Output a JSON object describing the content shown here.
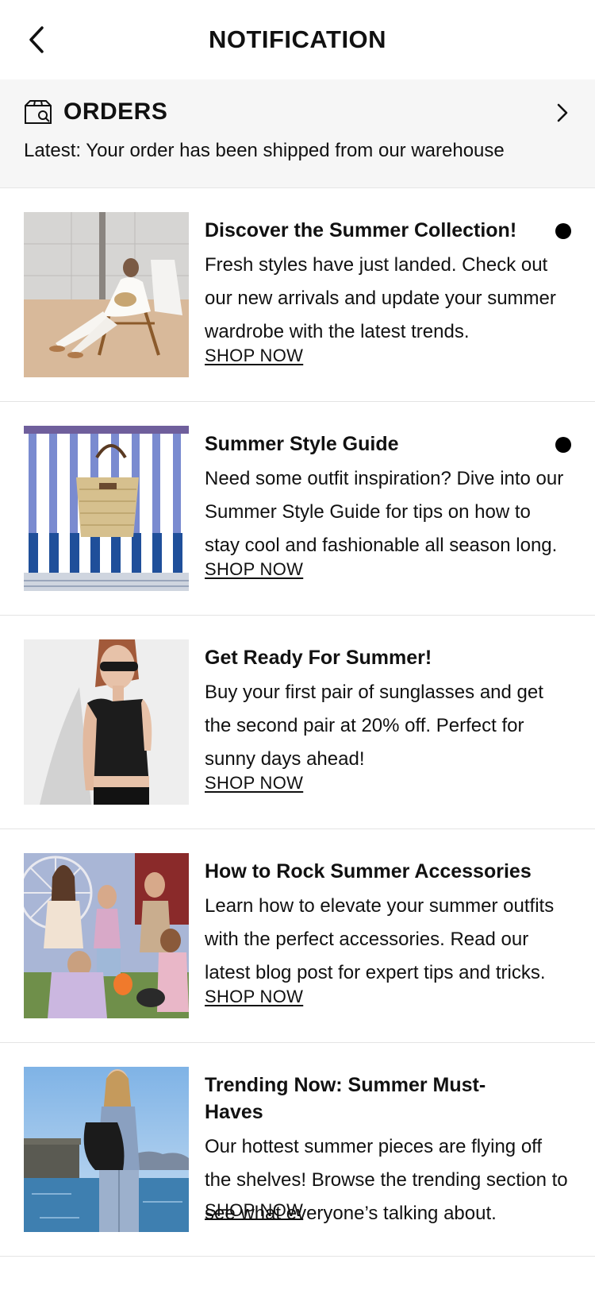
{
  "header": {
    "title": "NOTIFICATION",
    "back_icon": "chevron-left-icon"
  },
  "orders": {
    "title": "ORDERS",
    "latest": "Latest: Your order has been shipped from our warehouse",
    "icon": "package-search-icon",
    "chevron_icon": "chevron-right-icon"
  },
  "notifications": [
    {
      "title": "Discover the Summer Collection!",
      "body": "Fresh styles have just landed. Check out our new arrivals and update your summer wardrobe with the latest trends.",
      "link": "SHOP NOW",
      "unread": true
    },
    {
      "title": "Summer Style Guide",
      "body": "Need some outfit inspiration? Dive into our Summer Style Guide for tips on how to stay cool and fashionable all season long.",
      "link": "SHOP NOW",
      "unread": true
    },
    {
      "title": "Get Ready For Summer!",
      "body": "Buy your first pair of sunglasses and get the second pair at 20% off. Perfect for sunny days ahead!",
      "link": "SHOP NOW",
      "unread": false
    },
    {
      "title": "How to Rock Summer Accessories",
      "body": "Learn how to elevate your summer outfits with the perfect accessories. Read our latest blog post for expert tips and tricks.",
      "link": "SHOP NOW",
      "unread": false
    },
    {
      "title": "Trending Now: Summer Must-Haves",
      "body": "Our hottest summer pieces are flying off the shelves! Browse the trending section to see what everyone’s talking about.",
      "link": "SHOP NOW",
      "unread": false
    }
  ],
  "colors": {
    "orders_background": "#f6f6f6",
    "divider": "#e4e4e4",
    "text": "#111111",
    "unread_dot": "#000000"
  }
}
